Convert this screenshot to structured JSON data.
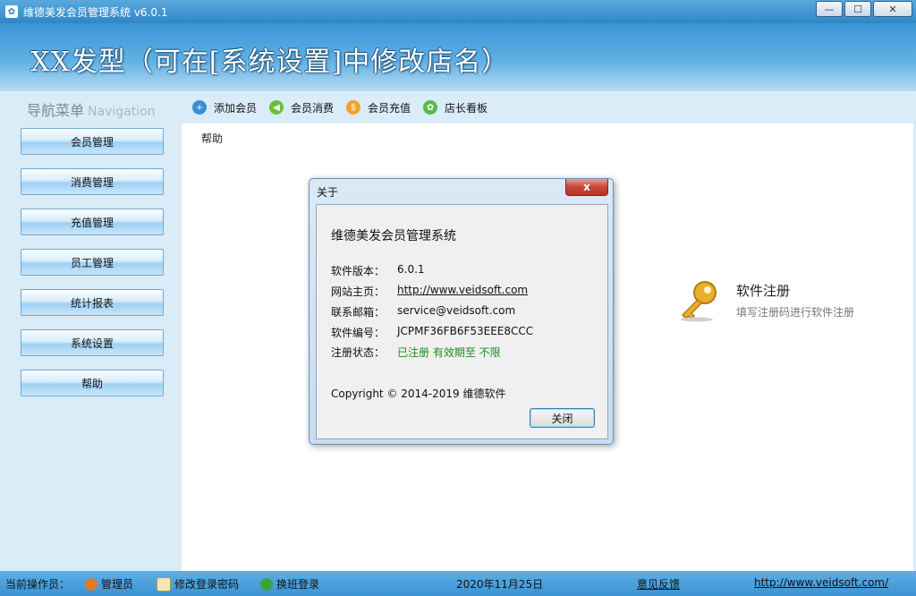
{
  "window": {
    "title": "维德美发会员管理系统 v6.0.1",
    "buttons": [
      "—",
      "☐",
      "✕"
    ]
  },
  "header": {
    "shop_name": "XX发型（可在[系统设置]中修改店名）"
  },
  "nav": {
    "title": "导航菜单",
    "title_en": "Navigation",
    "items": [
      {
        "label": "会员管理"
      },
      {
        "label": "消费管理"
      },
      {
        "label": "充值管理"
      },
      {
        "label": "员工管理"
      },
      {
        "label": "统计报表"
      },
      {
        "label": "系统设置"
      },
      {
        "label": "帮助"
      }
    ]
  },
  "toolbar": {
    "items": [
      {
        "label": "添加会员",
        "icon": "add-member-icon",
        "color": "#3a8fd4"
      },
      {
        "label": "会员消费",
        "icon": "consume-icon",
        "color": "#6bbf3a"
      },
      {
        "label": "会员充值",
        "icon": "recharge-icon",
        "color": "#f0a32a"
      },
      {
        "label": "店长看板",
        "icon": "dashboard-icon",
        "color": "#58b84a"
      }
    ]
  },
  "content": {
    "menu": "帮助",
    "register": {
      "title": "软件注册",
      "subtitle": "填写注册码进行软件注册"
    }
  },
  "dialog": {
    "title": "关于",
    "close_glyph": "x",
    "app_name": "维德美发会员管理系统",
    "rows": [
      {
        "key": "软件版本：",
        "value": "6.0.1"
      },
      {
        "key": "网站主页：",
        "value": "http://www.veidsoft.com"
      },
      {
        "key": "联系邮箱：",
        "value": "service@veidsoft.com"
      },
      {
        "key": "软件编号：",
        "value": "JCPMF36FB6F53EEE8CCC"
      },
      {
        "key": "注册状态：",
        "value": "已注册 有效期至 不限"
      }
    ],
    "copyright": "Copyright © 2014-2019 维德软件",
    "close_button": "关闭"
  },
  "status": {
    "operator_label": "当前操作员：",
    "operator": "管理员",
    "change_password": "修改登录密码",
    "switch_shift": "换班登录",
    "date": "2020年11月25日",
    "feedback": "意见反馈",
    "url": "http://www.veidsoft.com/"
  },
  "colors": {
    "accent": "#3b92d1",
    "registered": "#1e8a1e"
  }
}
